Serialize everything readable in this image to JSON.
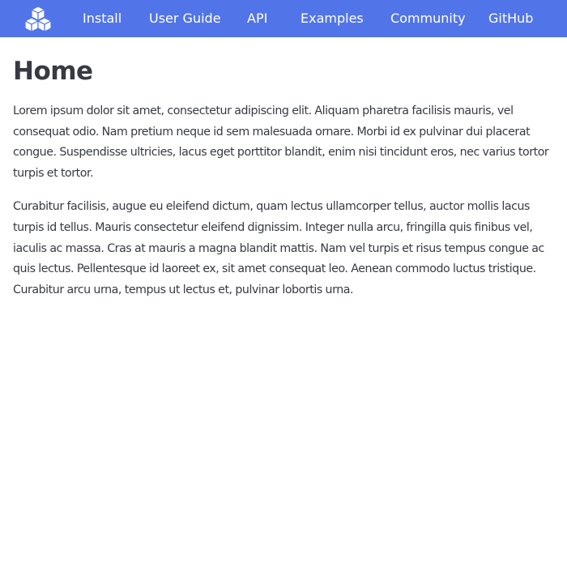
{
  "navbar": {
    "logo_icon": "cubes-logo-icon",
    "background": "#5175e8",
    "items": [
      {
        "label": "Install"
      },
      {
        "label": "User Guide"
      },
      {
        "label": "API"
      },
      {
        "label": "Examples"
      },
      {
        "label": "Community"
      },
      {
        "label": "GitHub"
      }
    ]
  },
  "main": {
    "title": "Home",
    "paragraphs": [
      "Lorem ipsum dolor sit amet, consectetur adipiscing elit. Aliquam pharetra facilisis mauris, vel consequat odio. Nam pretium neque id sem malesuada ornare. Morbi id ex pulvinar dui placerat congue. Suspendisse ultricies, lacus eget porttitor blandit, enim nisi tincidunt eros, nec varius tortor turpis et tortor.",
      "Curabitur facilisis, augue eu eleifend dictum, quam lectus ullamcorper tellus, auctor mollis lacus turpis id tellus. Mauris consectetur eleifend dignissim. Integer nulla arcu, fringilla quis finibus vel, iaculis ac massa. Cras at mauris a magna blandit mattis. Nam vel turpis et risus tempus congue ac quis lectus. Pellentesque id laoreet ex, sit amet consequat leo. Aenean commodo luctus tristique. Curabitur arcu urna, tempus ut lectus et, pulvinar lobortis urna."
    ]
  }
}
